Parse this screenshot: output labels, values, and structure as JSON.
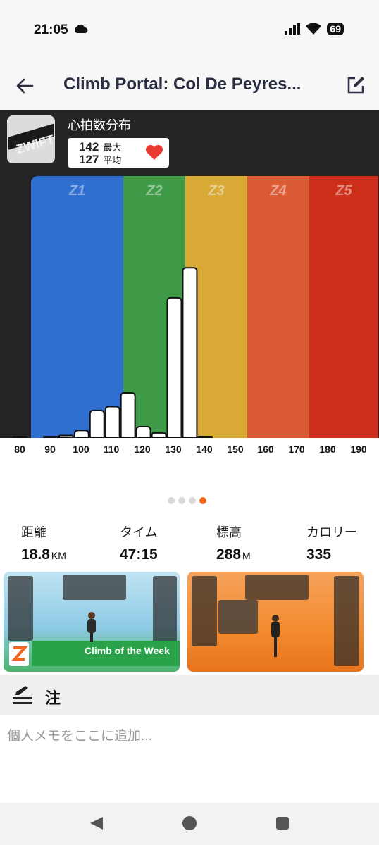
{
  "status_bar": {
    "time": "21:05",
    "battery": "69"
  },
  "app_bar": {
    "title": "Climb Portal: Col De Peyres..."
  },
  "heart_rate": {
    "heading": "心拍数分布",
    "max_value": "142",
    "max_label": "最大",
    "avg_value": "127",
    "avg_label": "平均"
  },
  "zones": [
    {
      "label": "Z1",
      "color": "#2f6fd0"
    },
    {
      "label": "Z2",
      "color": "#3f9a47"
    },
    {
      "label": "Z3",
      "color": "#d8a935"
    },
    {
      "label": "Z4",
      "color": "#d95a33"
    },
    {
      "label": "Z5",
      "color": "#cc2e1a"
    }
  ],
  "chart_data": {
    "type": "bar",
    "title": "心拍数分布",
    "x_ticks": [
      "80",
      "90",
      "100",
      "110",
      "120",
      "130",
      "140",
      "150",
      "160",
      "170",
      "180",
      "190"
    ],
    "bins": [
      80,
      85,
      90,
      95,
      100,
      105,
      110,
      115,
      120,
      125,
      130,
      135,
      140,
      145
    ],
    "values": [
      0.5,
      0,
      0.4,
      1,
      3,
      11,
      12.5,
      18,
      4.5,
      2,
      56,
      68,
      0.5,
      0
    ],
    "ylim": [
      0,
      72
    ],
    "zone_boundaries": [
      87,
      115,
      135,
      155,
      175,
      190
    ]
  },
  "carousel": {
    "count": 4,
    "active": 3
  },
  "stats": [
    {
      "label": "距離",
      "value": "18.8",
      "unit": "KM"
    },
    {
      "label": "タイム",
      "value": "47:15",
      "unit": ""
    },
    {
      "label": "標高",
      "value": "288",
      "unit": "M"
    },
    {
      "label": "カロリー",
      "value": "335",
      "unit": ""
    }
  ],
  "thumbnails": [
    {
      "banner": "Climb of the Week"
    },
    {
      "banner": ""
    }
  ],
  "notes": {
    "title": "注",
    "placeholder": "個人メモをここに追加..."
  }
}
